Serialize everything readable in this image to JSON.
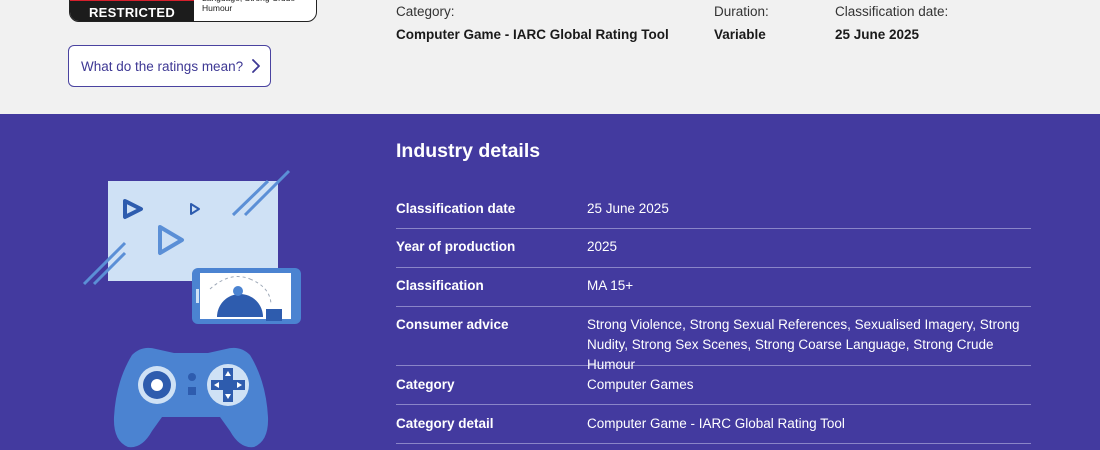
{
  "badge": {
    "word": "RESTRICTED",
    "advice_partial": "Language, Strong Crude Humour"
  },
  "ratings_button": {
    "label": "What do the ratings mean?",
    "icon": "chevron-right-icon"
  },
  "summary": [
    {
      "label": "Category:",
      "value": "Computer Game - IARC Global Rating Tool"
    },
    {
      "label": "Duration:",
      "value": "Variable"
    },
    {
      "label": "Classification date:",
      "value": "25 June 2025"
    }
  ],
  "industry": {
    "heading": "Industry details",
    "rows": [
      {
        "key": "Classification date",
        "value": "25 June 2025"
      },
      {
        "key": "Year of production",
        "value": "2025"
      },
      {
        "key": "Classification",
        "value": "MA 15+"
      },
      {
        "key": "Consumer advice",
        "value": "Strong Violence, Strong Sexual References, Sexualised Imagery, Strong Nudity, Strong Sex Scenes, Strong Coarse Language, Strong Crude Humour"
      },
      {
        "key": "Category",
        "value": "Computer Games"
      },
      {
        "key": "Category detail",
        "value": "Computer Game - IARC Global Rating Tool"
      }
    ]
  },
  "colors": {
    "band": "#433a9f",
    "accent": "#3e3894",
    "badge_red": "#d6202c"
  }
}
